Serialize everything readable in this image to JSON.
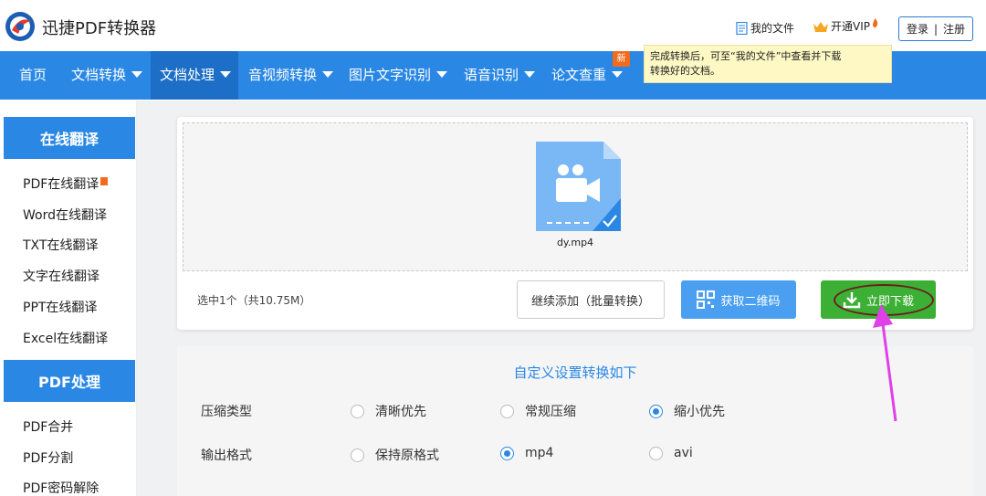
{
  "header": {
    "app_title": "迅捷PDF转换器",
    "my_files": "我的文件",
    "vip": "开通VIP",
    "login": "登录",
    "separator": "|",
    "register": "注册"
  },
  "nav": {
    "items": [
      {
        "label": "首页",
        "has_caret": false
      },
      {
        "label": "文档转换",
        "has_caret": true
      },
      {
        "label": "文档处理",
        "has_caret": true,
        "active": true
      },
      {
        "label": "音视频转换",
        "has_caret": true
      },
      {
        "label": "图片文字识别",
        "has_caret": true
      },
      {
        "label": "语音识别",
        "has_caret": true
      },
      {
        "label": "论文查重",
        "has_caret": true
      }
    ],
    "new_badge": "新",
    "tooltip_line1": "完成转换后，可至“我的文件”中查看并下载",
    "tooltip_line2": "转换好的文档。"
  },
  "sidebar": {
    "sections": [
      {
        "heading": "在线翻译",
        "items": [
          "PDF在线翻译",
          "Word在线翻译",
          "TXT在线翻译",
          "文字在线翻译",
          "PPT在线翻译",
          "Excel在线翻译"
        ]
      },
      {
        "heading": "PDF处理",
        "items": [
          "PDF合并",
          "PDF分割",
          "PDF密码解除"
        ]
      }
    ]
  },
  "upload": {
    "file_name": "dy.mp4",
    "selected_info": "选中1个（共10.75M）",
    "continue_button": "继续添加（批量转换）",
    "qr_button": "获取二维码",
    "download_button": "立即下载"
  },
  "settings": {
    "title": "自定义设置转换如下",
    "compress_label": "压缩类型",
    "compress_options": [
      "清晰优先",
      "常规压缩",
      "缩小优先"
    ],
    "compress_selected": "缩小优先",
    "format_label": "输出格式",
    "format_options": [
      "保持原格式",
      "mp4",
      "avi"
    ],
    "format_selected": "mp4"
  },
  "colors": {
    "nav_bg": "#2a88e4",
    "nav_active": "#1c6ec7",
    "download_green": "#3cb034",
    "qr_blue": "#4a9ff0",
    "annotation_arrow": "#e040e8",
    "annotation_ellipse": "#6b1e1e"
  }
}
